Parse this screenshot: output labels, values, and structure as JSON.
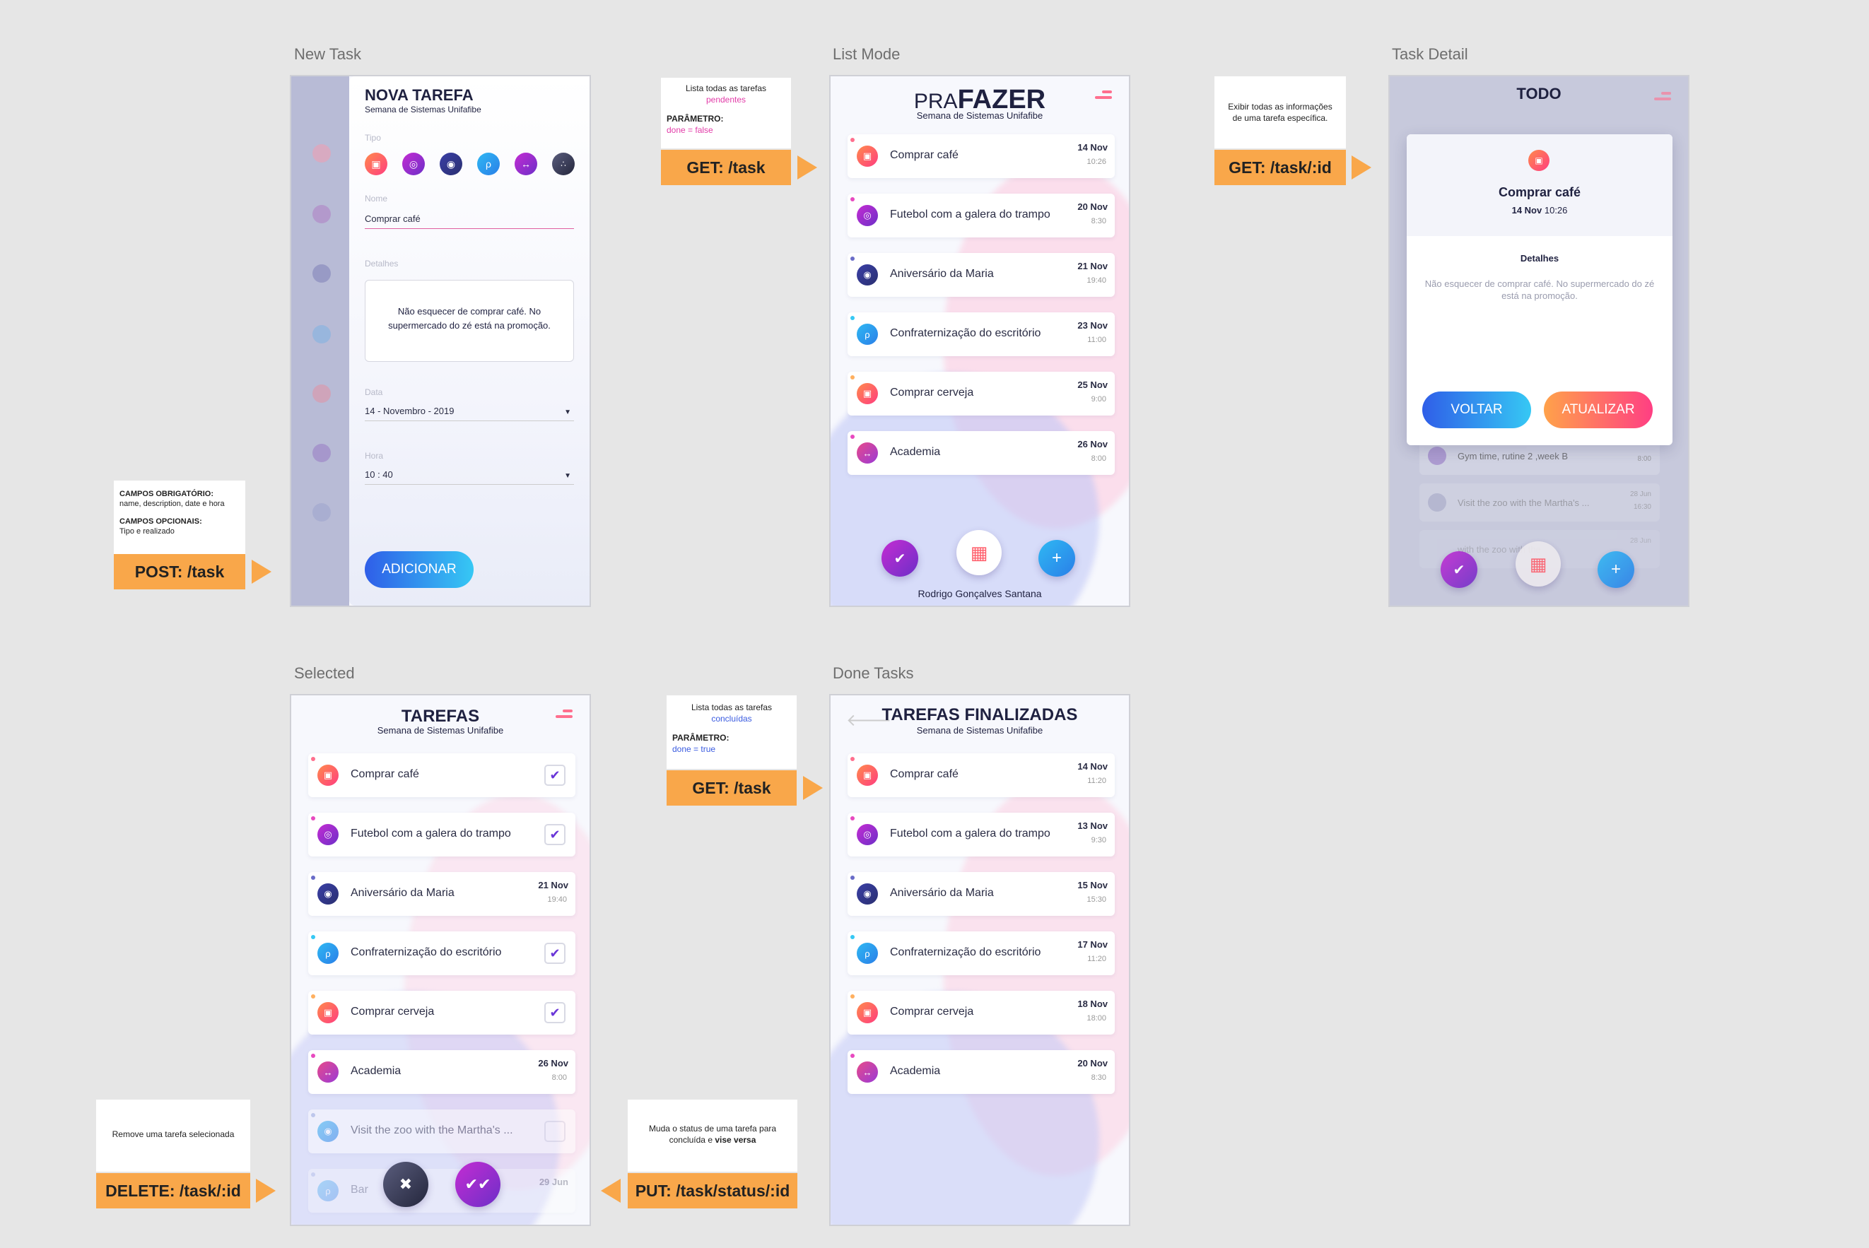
{
  "screen_titles": {
    "new_task": "New Task",
    "list_mode": "List Mode",
    "task_detail": "Task Detail",
    "selected": "Selected",
    "done_tasks": "Done Tasks"
  },
  "new_task": {
    "title": "NOVA TAREFA",
    "subtitle": "Semana de Sistemas Unifafibe",
    "tipo_label": "Tipo",
    "nome_label": "Nome",
    "nome_value": "Comprar café",
    "detalhes_label": "Detalhes",
    "detalhes_value": "Não esquecer de comprar café. No supermercado do zé está na promoção.",
    "data_label": "Data",
    "data_value": "14 - Novembro - 2019",
    "hora_label": "Hora",
    "hora_value": "10 : 40",
    "add_button": "ADICIONAR"
  },
  "list_mode": {
    "brand_pre": "PRA",
    "brand_main": "FAZER",
    "subtitle": "Semana de Sistemas Unifafibe",
    "user": "Rodrigo Gonçalves Santana",
    "tasks": [
      {
        "name": "Comprar café",
        "date": "14 Nov",
        "time": "10:26"
      },
      {
        "name": "Futebol com a galera do trampo",
        "date": "20 Nov",
        "time": "8:30"
      },
      {
        "name": "Aniversário da Maria",
        "date": "21 Nov",
        "time": "19:40"
      },
      {
        "name": "Confraternização do escritório",
        "date": "23 Nov",
        "time": "11:00"
      },
      {
        "name": "Comprar cerveja",
        "date": "25 Nov",
        "time": "9:00"
      },
      {
        "name": "Academia",
        "date": "26 Nov",
        "time": "8:00"
      }
    ]
  },
  "task_detail": {
    "title": "TODO",
    "task_name": "Comprar café",
    "task_date": "14 Nov",
    "task_time": "10:26",
    "detalhes_label": "Detalhes",
    "detalhes_text": "Não esquecer de comprar café. No supermercado do zé está na promoção.",
    "back_button": "VOLTAR",
    "update_button": "ATUALIZAR",
    "bg_tasks": [
      {
        "name": "Gym time, rutine 2 ,week B",
        "date": "",
        "time": "8:00"
      },
      {
        "name": "Visit the zoo with the  Martha's ...",
        "date": "28 Jun",
        "time": "16:30"
      },
      {
        "name": "with the zoo with the",
        "date": "28 Jun",
        "time": ""
      }
    ]
  },
  "selected": {
    "title": "TAREFAS",
    "subtitle": "Semana de Sistemas Unifafibe",
    "tasks": [
      {
        "name": "Comprar café",
        "date": "",
        "time": ""
      },
      {
        "name": "Futebol com a galera do trampo",
        "date": "",
        "time": ""
      },
      {
        "name": "Aniversário da Maria",
        "date": "21 Nov",
        "time": "19:40"
      },
      {
        "name": "Confraternização do escritório",
        "date": "",
        "time": ""
      },
      {
        "name": "Comprar cerveja",
        "date": "",
        "time": ""
      },
      {
        "name": "Academia",
        "date": "26 Nov",
        "time": "8:00"
      },
      {
        "name": "Visit the zoo with the  Martha's ...",
        "date": "",
        "time": ""
      },
      {
        "name": "Bar",
        "date": "29 Jun",
        "time": ""
      }
    ]
  },
  "done_tasks": {
    "title": "TAREFAS FINALIZADAS",
    "subtitle": "Semana de Sistemas Unifafibe",
    "tasks": [
      {
        "name": "Comprar café",
        "date": "14 Nov",
        "time": "11:20"
      },
      {
        "name": "Futebol com a galera do trampo",
        "date": "13 Nov",
        "time": "9:30"
      },
      {
        "name": "Aniversário da Maria",
        "date": "15 Nov",
        "time": "15:30"
      },
      {
        "name": "Confraternização do escritório",
        "date": "17 Nov",
        "time": "11:20"
      },
      {
        "name": "Comprar cerveja",
        "date": "18 Nov",
        "time": "18:00"
      },
      {
        "name": "Academia",
        "date": "20 Nov",
        "time": "8:30"
      }
    ]
  },
  "notes": {
    "post_required_title": "CAMPOS OBRIGATÓRIO:",
    "post_required": "name, description, date e hora",
    "post_optional_title": "CAMPOS OPCIONAIS:",
    "post_optional": "Tipo e realizado",
    "get_pending_line1": "Lista todas as tarefas",
    "get_pending_line2": "pendentes",
    "param_title": "PARÂMETRO:",
    "get_pending_param": "done = false",
    "get_id_text": "Exibir todas as informações de uma tarefa específica.",
    "get_done_line1": "Lista todas as tarefas",
    "get_done_line2": "concluídas",
    "get_done_param": "done = true",
    "delete_text": "Remove uma tarefa selecionada",
    "put_text": "Muda o status de uma tarefa para concluída e ",
    "put_bold": "vise versa"
  },
  "endpoints": {
    "post": "POST: /task",
    "get_list": "GET: /task",
    "get_id": "GET: /task/:id",
    "get_done": "GET: /task",
    "delete": "DELETE: /task/:id",
    "put": "PUT: /task/status/:id"
  },
  "colors": {
    "accent_orange": "#f9a74a",
    "pink": "#ff3d7f",
    "purple": "#6d2fc8",
    "blue": "#2a7fe8",
    "navy": "#1f2140"
  }
}
